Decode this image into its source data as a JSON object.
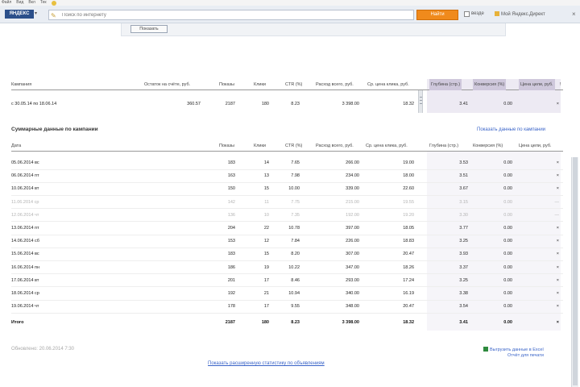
{
  "menu": [
    "Файл",
    "Вид",
    "Вкл",
    "Тек"
  ],
  "toolbar": {
    "brand": "ЯНДЕКС",
    "search_placeholder": "Поиск по интернету",
    "find_label": "Найти",
    "checkbox_label": "везде",
    "right_link": "Мой Яндекс.Директ",
    "close": "×"
  },
  "subpanel": {
    "button": "Показать"
  },
  "summary": {
    "headers": [
      "Кампания",
      "Остаток на счёте, руб.",
      "Показы",
      "Клики",
      "CTR (%)",
      "Расход всего, руб.",
      "Ср. цена клика, руб.",
      "Глубина (стр.)",
      "Конверсия (%)",
      "Цена цели, руб.",
      "!"
    ],
    "row": [
      "с 30.05.14 по 18.06.14",
      "360.57",
      "2187",
      "180",
      "8.23",
      "3 398.00",
      "18.32",
      "3.41",
      "0.00",
      "",
      "×"
    ]
  },
  "detail": {
    "title": "Суммарные данные по кампании",
    "link": "Показать данные по кампании",
    "headers": [
      "Дата",
      "Показы",
      "Клики",
      "CTR (%)",
      "Расход всего, руб.",
      "Ср. цена клика, руб.",
      "Глубина (стр.)",
      "Конверсия (%)",
      "Цена цели, руб."
    ],
    "rows": [
      {
        "muted": false,
        "cells": [
          "05.06.2014 вс",
          "183",
          "14",
          "7.65",
          "266.00",
          "19.00",
          "3.53",
          "0.00",
          "×"
        ]
      },
      {
        "muted": false,
        "cells": [
          "06.06.2014 пт",
          "163",
          "13",
          "7.98",
          "234.00",
          "18.00",
          "3.51",
          "0.00",
          "×"
        ]
      },
      {
        "muted": false,
        "cells": [
          "10.06.2014 вт",
          "150",
          "15",
          "10.00",
          "339.00",
          "22.60",
          "3.67",
          "0.00",
          "×"
        ]
      },
      {
        "muted": true,
        "cells": [
          "11.06.2014 ср",
          "142",
          "11",
          "7.75",
          "215.00",
          "19.55",
          "3.15",
          "0.00",
          "—"
        ]
      },
      {
        "muted": true,
        "cells": [
          "12.06.2014 чт",
          "136",
          "10",
          "7.35",
          "192.00",
          "19.20",
          "3.30",
          "0.00",
          "—"
        ]
      },
      {
        "muted": false,
        "cells": [
          "13.06.2014 пт",
          "204",
          "22",
          "10.78",
          "397.00",
          "18.05",
          "3.77",
          "0.00",
          "×"
        ]
      },
      {
        "muted": false,
        "cells": [
          "14.06.2014 сб",
          "153",
          "12",
          "7.84",
          "226.00",
          "18.83",
          "3.25",
          "0.00",
          "×"
        ]
      },
      {
        "muted": false,
        "cells": [
          "15.06.2014 вс",
          "183",
          "15",
          "8.20",
          "307.00",
          "20.47",
          "3.93",
          "0.00",
          "×"
        ]
      },
      {
        "muted": false,
        "cells": [
          "16.06.2014 пн",
          "186",
          "19",
          "10.22",
          "347.00",
          "18.26",
          "3.37",
          "0.00",
          "×"
        ]
      },
      {
        "muted": false,
        "cells": [
          "17.06.2014 вт",
          "201",
          "17",
          "8.46",
          "293.00",
          "17.24",
          "3.25",
          "0.00",
          "×"
        ]
      },
      {
        "muted": false,
        "cells": [
          "18.06.2014 ср",
          "192",
          "21",
          "10.94",
          "340.00",
          "16.19",
          "3.38",
          "0.00",
          "×"
        ]
      },
      {
        "muted": false,
        "cells": [
          "19.06.2014 чт",
          "178",
          "17",
          "9.55",
          "348.00",
          "20.47",
          "3.54",
          "0.00",
          "×"
        ]
      }
    ],
    "total": [
      "Итого",
      "2187",
      "180",
      "8.23",
      "3 398.00",
      "18.32",
      "3.41",
      "0.00",
      "×"
    ]
  },
  "footer": {
    "updated": "Обновлено: 20.06.2014 7:30",
    "export_line1": "Выгрузить данные в Excel",
    "export_line2": "Отчёт для печати",
    "bottom_link": "Показать расширенную статистику по объявлениям"
  }
}
